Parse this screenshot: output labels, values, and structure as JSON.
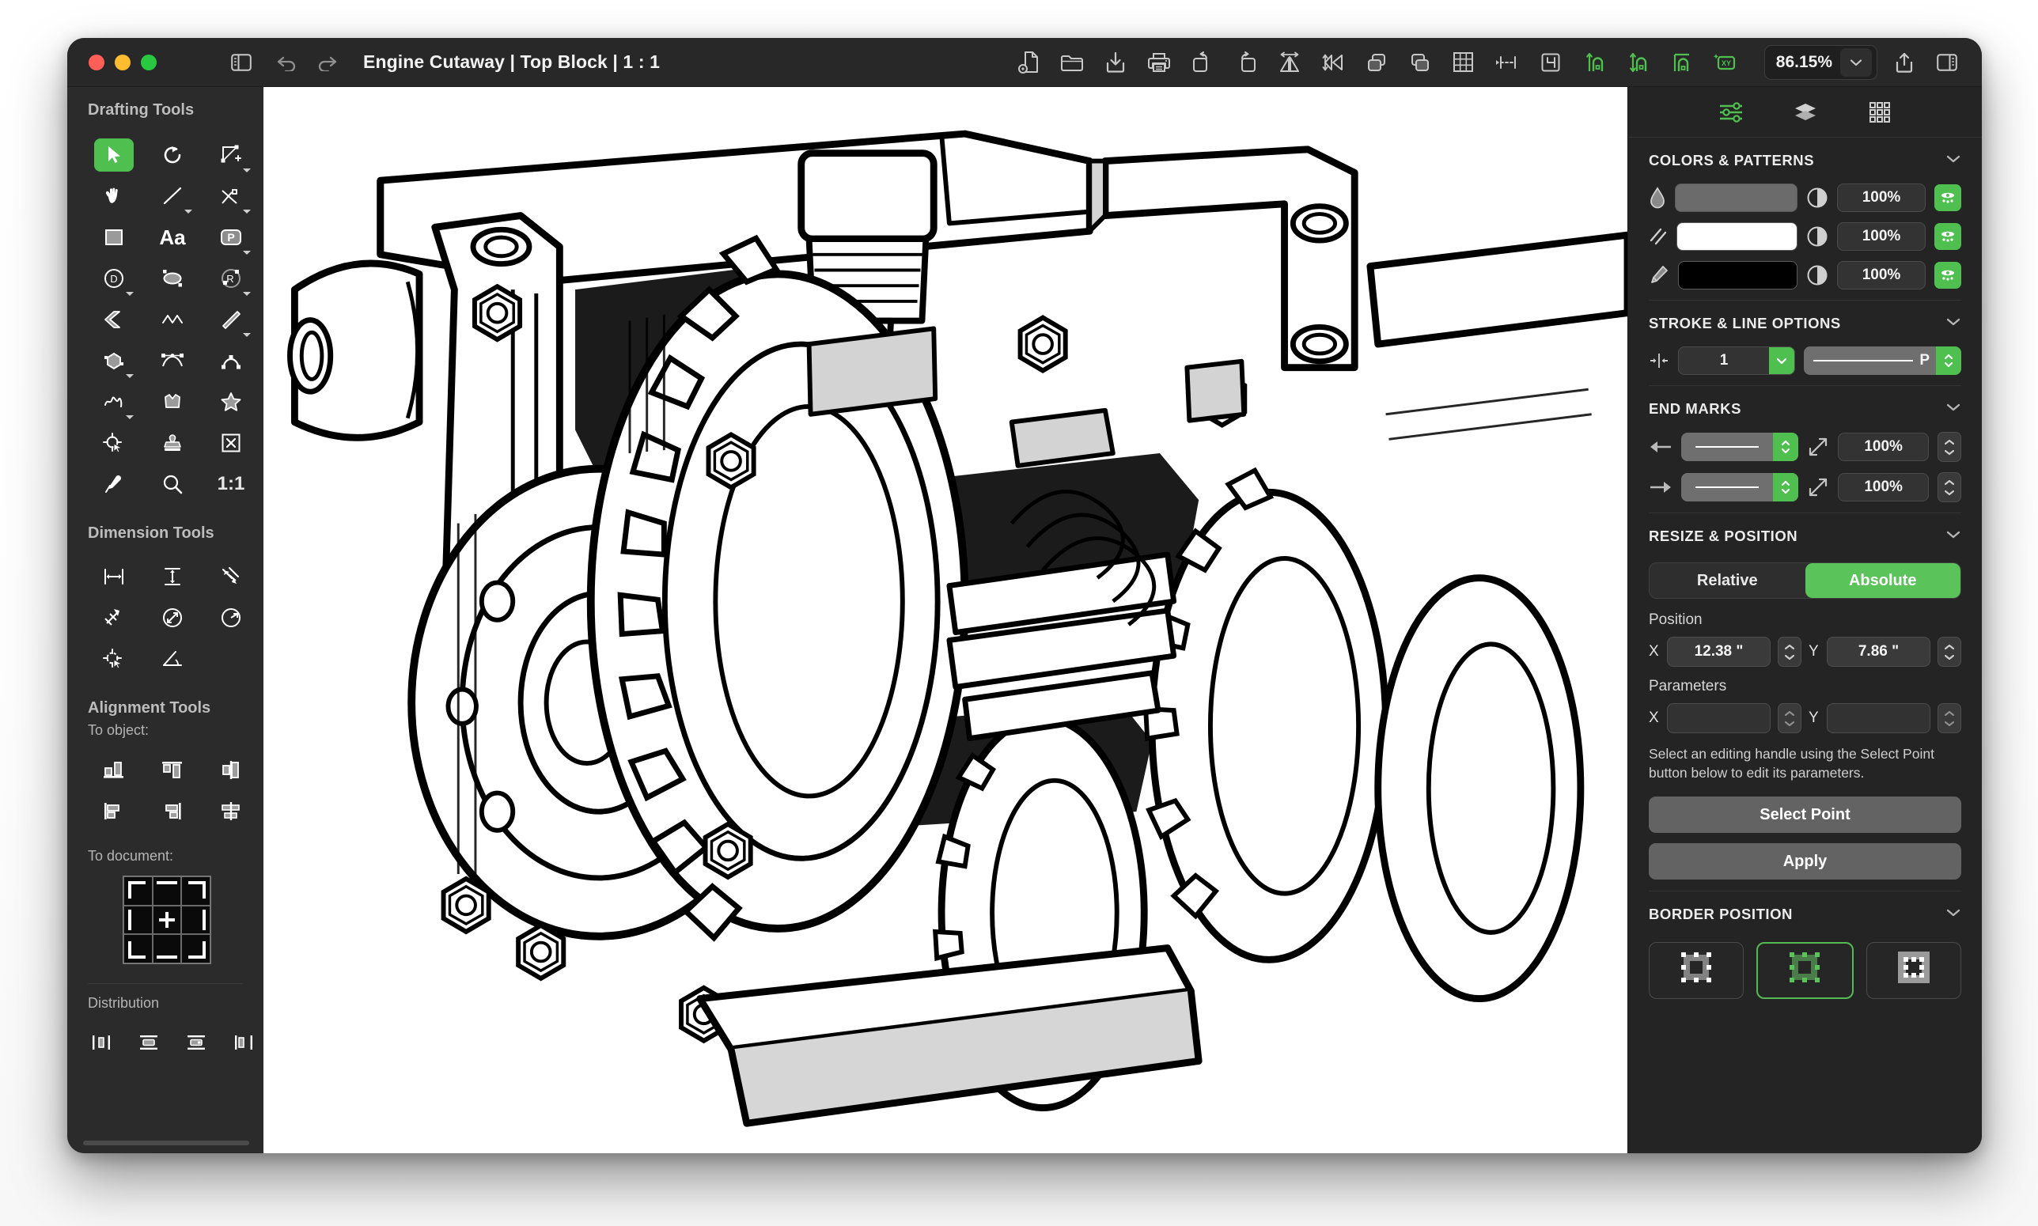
{
  "window": {
    "traffic_lights": [
      "close",
      "minimize",
      "zoom"
    ],
    "title": "Engine Cutaway | Top Block | 1 : 1"
  },
  "toolbar": {
    "sidebar_toggle_icon": "sidebar-left-icon",
    "undo_icon": "undo-icon",
    "redo_icon": "redo-icon",
    "tools": [
      {
        "icon": "document-settings-icon",
        "name": "document-settings"
      },
      {
        "icon": "folder-icon",
        "name": "open-folder"
      },
      {
        "icon": "import-icon",
        "name": "import"
      },
      {
        "icon": "print-icon",
        "name": "print"
      },
      {
        "icon": "rotate-left-icon",
        "name": "rotate-left"
      },
      {
        "icon": "rotate-right-icon",
        "name": "rotate-right"
      },
      {
        "icon": "flip-horizontal-icon",
        "name": "flip-horizontal"
      },
      {
        "icon": "flip-vertical-icon",
        "name": "flip-vertical"
      },
      {
        "icon": "bring-forward-icon",
        "name": "bring-forward"
      },
      {
        "icon": "send-backward-icon",
        "name": "send-backward"
      },
      {
        "icon": "grid-icon",
        "name": "show-grid"
      },
      {
        "icon": "snap-points-icon",
        "name": "snap-to-points"
      },
      {
        "icon": "crop-icon",
        "name": "crop-to-selection"
      }
    ],
    "green_tools": [
      {
        "icon": "snap-vertical-icon",
        "name": "snap-vertical"
      },
      {
        "icon": "snap-both-icon",
        "name": "snap-both"
      },
      {
        "icon": "snap-corner-icon",
        "name": "snap-corner"
      },
      {
        "icon": "xy-coordinates-icon",
        "name": "xy-coordinates"
      }
    ],
    "zoom_level": "86.15%",
    "zoom_chevron_icon": "chevron-down-icon",
    "share_icon": "share-icon",
    "inspector_toggle_icon": "sidebar-right-icon"
  },
  "sidebar": {
    "drafting_title": "Drafting Tools",
    "drafting_tools": [
      {
        "name": "select-tool",
        "icon": "arrow-cursor-icon",
        "active": true,
        "caret": false
      },
      {
        "name": "rotate-tool",
        "icon": "rotate-icon",
        "active": false,
        "caret": false
      },
      {
        "name": "shape-node-tool",
        "icon": "shape-node-icon",
        "active": false,
        "caret": true
      },
      {
        "name": "pan-tool",
        "icon": "hand-icon",
        "active": false,
        "caret": false
      },
      {
        "name": "line-tool",
        "icon": "line-icon",
        "active": false,
        "caret": true
      },
      {
        "name": "angle-line-tool",
        "icon": "angle-line-icon",
        "active": false,
        "caret": true
      },
      {
        "name": "rectangle-tool",
        "icon": "rectangle-icon",
        "active": false,
        "caret": false
      },
      {
        "name": "text-tool",
        "icon": "text-aa-icon",
        "active": false,
        "caret": false
      },
      {
        "name": "polygon-point-tool",
        "icon": "p-badge-icon",
        "active": false,
        "caret": true
      },
      {
        "name": "diameter-tool",
        "icon": "d-circle-icon",
        "active": false,
        "caret": true
      },
      {
        "name": "ellipse-tool",
        "icon": "ellipse-icon",
        "active": false,
        "caret": false
      },
      {
        "name": "radius-tool",
        "icon": "r-circle-icon",
        "active": false,
        "caret": true
      },
      {
        "name": "chamfer-tool",
        "icon": "chevron-solid-icon",
        "active": false,
        "caret": false
      },
      {
        "name": "polyline-tool",
        "icon": "zigzag-icon",
        "active": false,
        "caret": false
      },
      {
        "name": "parallel-line-tool",
        "icon": "parallel-lines-icon",
        "active": false,
        "caret": true
      },
      {
        "name": "polygon-tool",
        "icon": "hexagon-icon",
        "active": false,
        "caret": true
      },
      {
        "name": "bezier-tool",
        "icon": "bezier-curve-icon",
        "active": false,
        "caret": false
      },
      {
        "name": "arc-tool",
        "icon": "arc-icon",
        "active": false,
        "caret": false
      },
      {
        "name": "freehand-tool",
        "icon": "scribble-icon",
        "active": false,
        "caret": true
      },
      {
        "name": "blob-shape-tool",
        "icon": "blob-icon",
        "active": false,
        "caret": false
      },
      {
        "name": "star-tool",
        "icon": "star-icon",
        "active": false,
        "caret": false
      },
      {
        "name": "reference-point-tool",
        "icon": "crosshair-arrow-icon",
        "active": false,
        "caret": false
      },
      {
        "name": "stamp-tool",
        "icon": "stamp-icon",
        "active": false,
        "caret": false
      },
      {
        "name": "delete-point-tool",
        "icon": "x-box-icon",
        "active": false,
        "caret": false
      },
      {
        "name": "eyedropper-tool",
        "icon": "eyedropper-icon",
        "active": false,
        "caret": false
      },
      {
        "name": "zoom-tool",
        "icon": "magnifier-icon",
        "active": false,
        "caret": false
      },
      {
        "name": "actual-size-tool",
        "icon": "ratio-1-1-text",
        "label": "1:1",
        "active": false,
        "caret": false
      }
    ],
    "dimension_title": "Dimension Tools",
    "dimension_tools": [
      {
        "name": "horizontal-dimension",
        "icon": "horizontal-dimension-icon"
      },
      {
        "name": "vertical-dimension",
        "icon": "vertical-dimension-icon"
      },
      {
        "name": "aligned-dimension",
        "icon": "aligned-dimension-icon"
      },
      {
        "name": "leader-dimension",
        "icon": "leader-dimension-icon"
      },
      {
        "name": "diameter-dimension",
        "icon": "diameter-dimension-icon"
      },
      {
        "name": "radius-dimension",
        "icon": "radius-dimension-icon"
      },
      {
        "name": "datum-point",
        "icon": "datum-point-icon"
      },
      {
        "name": "angle-dimension",
        "icon": "angle-dimension-icon"
      }
    ],
    "alignment_title": "Alignment Tools",
    "to_object_label": "To object:",
    "align_object_tools": [
      {
        "name": "align-bottom",
        "icon": "align-bottom-icon"
      },
      {
        "name": "align-top",
        "icon": "align-top-icon"
      },
      {
        "name": "align-center-vertical",
        "icon": "align-center-vertical-icon"
      },
      {
        "name": "align-left",
        "icon": "align-left-icon"
      },
      {
        "name": "align-right",
        "icon": "align-right-icon"
      },
      {
        "name": "align-center-horizontal",
        "icon": "align-center-horizontal-icon"
      }
    ],
    "to_document_label": "To document:",
    "document_align_grid_icon": "nine-cell-align-grid-icon",
    "distribution_label": "Distribution",
    "distribution_tools": [
      {
        "name": "distribute-horizontal-centers",
        "icon": "distribute-h-centers-icon"
      },
      {
        "name": "distribute-vertical-centers",
        "icon": "distribute-v-centers-icon"
      },
      {
        "name": "distribute-vertical-right",
        "icon": "distribute-v-right-icon"
      },
      {
        "name": "distribute-horizontal-edges",
        "icon": "distribute-h-edges-icon"
      }
    ]
  },
  "canvas": {
    "artwork_name": "engine-cutaway-technical-illustration",
    "description": "Black-and-white technical cutaway line drawing of an engine gearbox with bolted flange, large toothed gear, hex bolts and a gear train"
  },
  "inspector": {
    "tabs": [
      {
        "name": "tab-attributes",
        "icon": "sliders-icon",
        "active": true
      },
      {
        "name": "tab-layers",
        "icon": "layers-icon",
        "active": false
      },
      {
        "name": "tab-library",
        "icon": "grid-9-icon",
        "active": false
      }
    ],
    "colors": {
      "title": "COLORS & PATTERNS",
      "collapse_icon": "chevron-down-icon",
      "rows": [
        {
          "name": "fill",
          "icon": "droplet-icon",
          "swatch": "#6b6b6b",
          "opacity": "100%",
          "toggle_icon": "pattern-toggle-icon",
          "contrast_icon": "contrast-half-icon"
        },
        {
          "name": "stroke-pattern",
          "icon": "hatch-lines-icon",
          "swatch": "#ffffff",
          "opacity": "100%",
          "toggle_icon": "pattern-toggle-icon",
          "contrast_icon": "contrast-half-icon"
        },
        {
          "name": "pen",
          "icon": "pencil-icon",
          "swatch": "#000000",
          "opacity": "100%",
          "toggle_icon": "pattern-toggle-icon",
          "contrast_icon": "contrast-half-icon"
        }
      ]
    },
    "stroke": {
      "title": "STROKE & LINE OPTIONS",
      "collapse_icon": "chevron-down-icon",
      "width_icon": "line-width-icon",
      "width_value": "1",
      "width_chevron_icon": "chevron-down-icon",
      "style_unit": "P",
      "style_line_icon": "solid-line-icon",
      "style_stepper_icon": "up-down-chevrons-icon"
    },
    "end_marks": {
      "title": "END MARKS",
      "collapse_icon": "chevron-down-icon",
      "rows": [
        {
          "name": "start-mark",
          "direction_icon": "arrow-left-icon",
          "style_icon": "solid-line-icon",
          "scale_icon": "resize-diagonal-icon",
          "scale": "100%"
        },
        {
          "name": "end-mark",
          "direction_icon": "arrow-right-icon",
          "style_icon": "solid-line-icon",
          "scale_icon": "resize-diagonal-icon",
          "scale": "100%"
        }
      ]
    },
    "resize": {
      "title": "RESIZE & POSITION",
      "collapse_icon": "chevron-down-icon",
      "mode_relative": "Relative",
      "mode_absolute": "Absolute",
      "mode_selected": "Absolute",
      "position_label": "Position",
      "position_x_axis": "X",
      "position_x": "12.38 \"",
      "position_y_axis": "Y",
      "position_y": "7.86 \"",
      "parameters_label": "Parameters",
      "parameters_x_axis": "X",
      "parameters_x": "",
      "parameters_y_axis": "Y",
      "parameters_y": "",
      "hint": "Select an editing handle using the Select Point button below to edit its parameters.",
      "select_point_label": "Select Point",
      "apply_label": "Apply"
    },
    "border_position": {
      "title": "BORDER POSITION",
      "collapse_icon": "chevron-down-icon",
      "options": [
        {
          "name": "border-inside",
          "icon": "border-inside-icon",
          "selected": false
        },
        {
          "name": "border-center",
          "icon": "border-center-icon",
          "selected": true
        },
        {
          "name": "border-outside",
          "icon": "border-outside-icon",
          "selected": false
        }
      ]
    }
  },
  "theme": {
    "accent_green": "#4fc04f",
    "window_bg": "#2b2b2b",
    "panel_bg": "#242424",
    "text": "#f0f0f0"
  }
}
